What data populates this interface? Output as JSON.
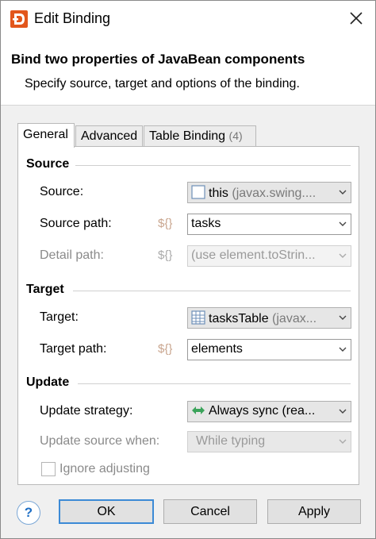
{
  "window": {
    "title": "Edit Binding",
    "header_title": "Bind two properties of JavaBean components",
    "header_subtitle": "Specify source, target and options of the binding."
  },
  "tabs": [
    {
      "label": "General",
      "active": true
    },
    {
      "label": "Advanced",
      "active": false
    },
    {
      "label": "Table Binding",
      "count": "(4)",
      "active": false
    }
  ],
  "source": {
    "heading": "Source",
    "source_label": "Source:",
    "source_value": "this",
    "source_type": "(javax.swing....",
    "source_path_label": "Source path:",
    "source_path_value": "tasks",
    "detail_path_label": "Detail path:",
    "detail_path_value": "(use element.toStrin...",
    "binding_icon_text": "${}"
  },
  "target": {
    "heading": "Target",
    "target_label": "Target:",
    "target_value": "tasksTable",
    "target_type": "(javax...",
    "target_path_label": "Target path:",
    "target_path_value": "elements"
  },
  "update": {
    "heading": "Update",
    "strategy_label": "Update strategy:",
    "strategy_value": "Always sync (rea...",
    "source_when_label": "Update source when:",
    "source_when_value": "While typing",
    "ignore_adjusting_label": "Ignore adjusting",
    "ignore_adjusting_checked": false
  },
  "buttons": {
    "help": "?",
    "ok": "OK",
    "cancel": "Cancel",
    "apply": "Apply"
  },
  "colors": {
    "accent_blue": "#3c8ad6",
    "app_icon": "#e2561c",
    "sync_arrows": "#3aa35a"
  }
}
